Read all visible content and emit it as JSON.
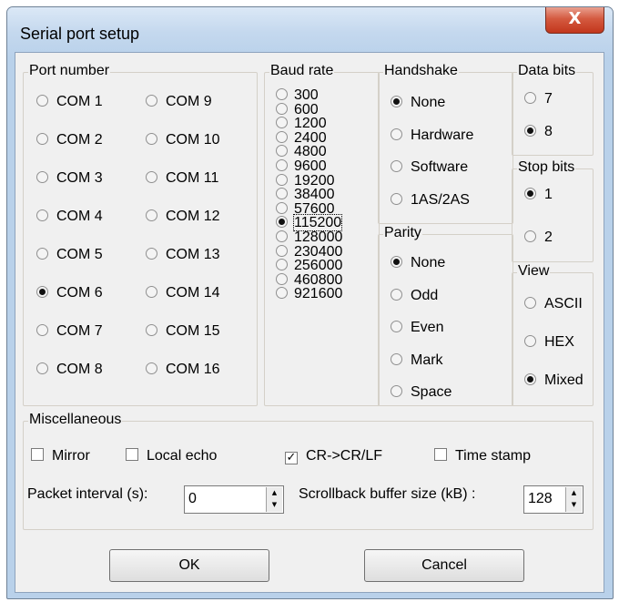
{
  "window": {
    "title": "Serial port setup",
    "close_icon": "close-icon",
    "close_glyph": "X"
  },
  "port_number": {
    "legend": "Port number",
    "options": [
      "COM 1",
      "COM 9",
      "COM 2",
      "COM 10",
      "COM 3",
      "COM 11",
      "COM 4",
      "COM 12",
      "COM 5",
      "COM 13",
      "COM 6",
      "COM 14",
      "COM 7",
      "COM 15",
      "COM 8",
      "COM 16"
    ],
    "selected": "COM 6"
  },
  "baud_rate": {
    "legend": "Baud rate",
    "options": [
      "300",
      "600",
      "1200",
      "2400",
      "4800",
      "9600",
      "19200",
      "38400",
      "57600",
      "115200",
      "128000",
      "230400",
      "256000",
      "460800",
      "921600"
    ],
    "selected": "115200"
  },
  "handshake": {
    "legend": "Handshake",
    "options": [
      "None",
      "Hardware",
      "Software",
      "1AS/2AS"
    ],
    "selected": "None"
  },
  "parity": {
    "legend": "Parity",
    "options": [
      "None",
      "Odd",
      "Even",
      "Mark",
      "Space"
    ],
    "selected": "None"
  },
  "data_bits": {
    "legend": "Data bits",
    "options": [
      "7",
      "8"
    ],
    "selected": "8"
  },
  "stop_bits": {
    "legend": "Stop bits",
    "options": [
      "1",
      "2"
    ],
    "selected": "1"
  },
  "view": {
    "legend": "View",
    "options": [
      "ASCII",
      "HEX",
      "Mixed"
    ],
    "selected": "Mixed"
  },
  "misc": {
    "legend": "Miscellaneous",
    "mirror": {
      "label": "Mirror",
      "checked": false
    },
    "local_echo": {
      "label": "Local echo",
      "checked": false
    },
    "crlf": {
      "label": "CR->CR/LF",
      "checked": true
    },
    "time_stamp": {
      "label": "Time stamp",
      "checked": false
    },
    "packet_interval_label": "Packet interval (s):",
    "packet_interval_value": "0",
    "scrollback_label": "Scrollback buffer size (kB) :",
    "scrollback_value": "128",
    "check_mark": "✓"
  },
  "buttons": {
    "ok": "OK",
    "cancel": "Cancel"
  }
}
